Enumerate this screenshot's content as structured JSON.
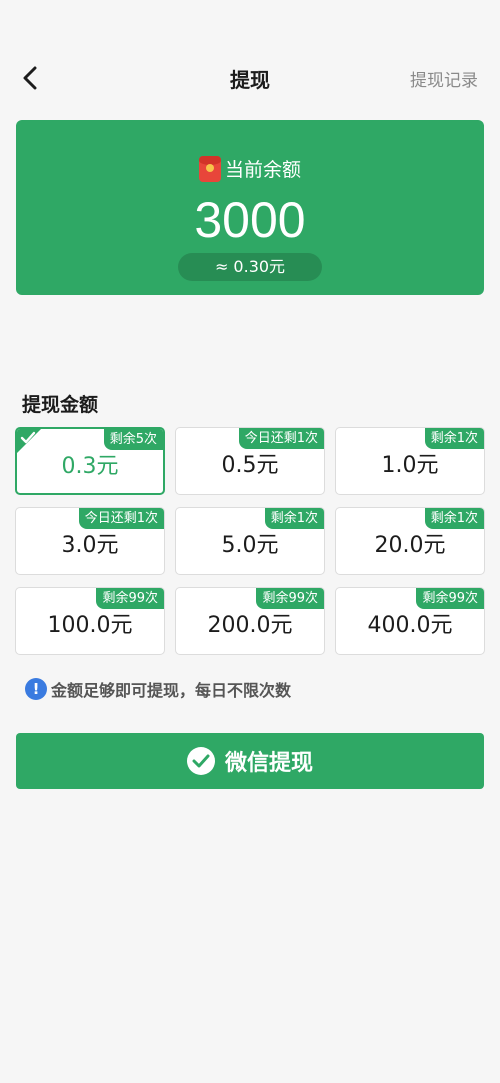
{
  "header": {
    "title": "提现",
    "history_link": "提现记录"
  },
  "balance": {
    "label": "当前余额",
    "amount": "3000",
    "approx": "≈ 0.30元"
  },
  "amount_section": {
    "title": "提现金额",
    "options": [
      {
        "value": "0.3元",
        "badge": "剩余5次",
        "selected": true
      },
      {
        "value": "0.5元",
        "badge": "今日还剩1次",
        "selected": false
      },
      {
        "value": "1.0元",
        "badge": "剩余1次",
        "selected": false
      },
      {
        "value": "3.0元",
        "badge": "今日还剩1次",
        "selected": false
      },
      {
        "value": "5.0元",
        "badge": "剩余1次",
        "selected": false
      },
      {
        "value": "20.0元",
        "badge": "剩余1次",
        "selected": false
      },
      {
        "value": "100.0元",
        "badge": "剩余99次",
        "selected": false
      },
      {
        "value": "200.0元",
        "badge": "剩余99次",
        "selected": false
      },
      {
        "value": "400.0元",
        "badge": "剩余99次",
        "selected": false
      }
    ]
  },
  "notice": {
    "text": "金额足够即可提现，每日不限次数"
  },
  "withdraw_button": {
    "label": "微信提现"
  },
  "colors": {
    "accent": "#2fa865",
    "info": "#3a7be0"
  }
}
